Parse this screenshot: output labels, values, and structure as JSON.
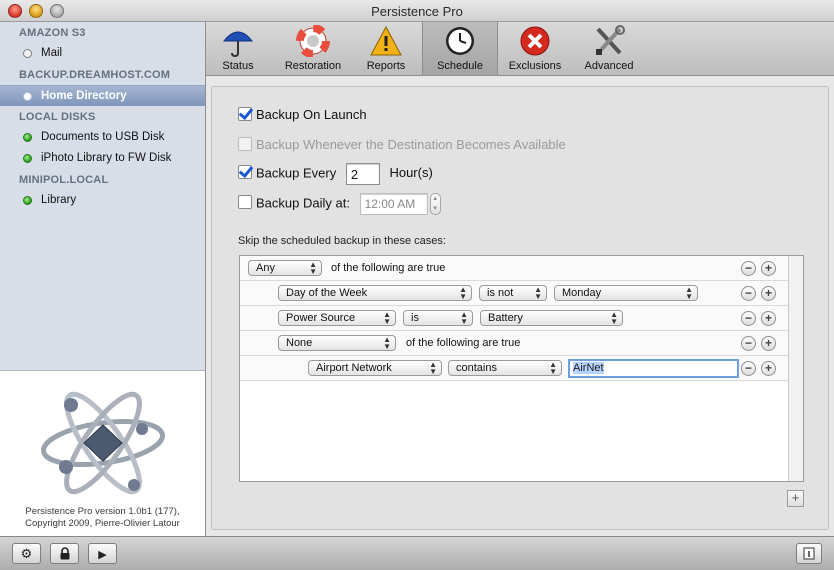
{
  "window": {
    "title": "Persistence Pro"
  },
  "toolbar": {
    "items": [
      {
        "label": "Status",
        "icon": "umbrella-icon"
      },
      {
        "label": "Restoration",
        "icon": "lifebuoy-icon"
      },
      {
        "label": "Reports",
        "icon": "warning-icon"
      },
      {
        "label": "Schedule",
        "icon": "clock-icon",
        "selected": true
      },
      {
        "label": "Exclusions",
        "icon": "exclusions-x-icon"
      },
      {
        "label": "Advanced",
        "icon": "tools-icon"
      }
    ]
  },
  "sidebar": {
    "groups": [
      {
        "header": "AMAZON S3",
        "items": [
          {
            "label": "Mail",
            "status": "gray"
          }
        ]
      },
      {
        "header": "BACKUP.DREAMHOST.COM",
        "items": [
          {
            "label": "Home Directory",
            "status": "white",
            "selected": true
          }
        ]
      },
      {
        "header": "LOCAL DISKS",
        "items": [
          {
            "label": "Documents to USB Disk",
            "status": "green"
          },
          {
            "label": "iPhoto Library to FW Disk",
            "status": "green"
          }
        ]
      },
      {
        "header": "MINIPOL.LOCAL",
        "items": [
          {
            "label": "Library",
            "status": "green"
          }
        ]
      }
    ],
    "version_line1": "Persistence Pro version 1.0b1 (177),",
    "version_line2": "Copyright 2009, Pierre-Olivier Latour"
  },
  "schedule": {
    "backup_on_launch": {
      "label": "Backup On Launch",
      "checked": true
    },
    "backup_when_available": {
      "label": "Backup Whenever the Destination Becomes Available",
      "checked": false,
      "enabled": false
    },
    "backup_every": {
      "label": "Backup Every",
      "checked": true,
      "value": "2",
      "unit": "Hour(s)"
    },
    "backup_daily": {
      "label": "Backup Daily at:",
      "checked": false,
      "time": "12:00 AM"
    },
    "skip_label": "Skip the scheduled backup in these cases:",
    "rules": {
      "row1": {
        "quantifier": "Any",
        "text": "of the following are true"
      },
      "row2": {
        "field": "Day of the Week",
        "op": "is not",
        "value": "Monday"
      },
      "row3": {
        "field": "Power Source",
        "op": "is",
        "value": "Battery"
      },
      "row4": {
        "quantifier": "None",
        "text": "of the following are true"
      },
      "row5": {
        "field": "Airport Network",
        "op": "contains",
        "value": "AirNet"
      }
    }
  },
  "bottom": {
    "gear": "⚙",
    "lock": "🔒",
    "play": "▶"
  },
  "colors": {
    "selection": "#7f95bb",
    "checkbox_blue": "#1b58d1",
    "sidebar_bg": "#d7dee8"
  }
}
